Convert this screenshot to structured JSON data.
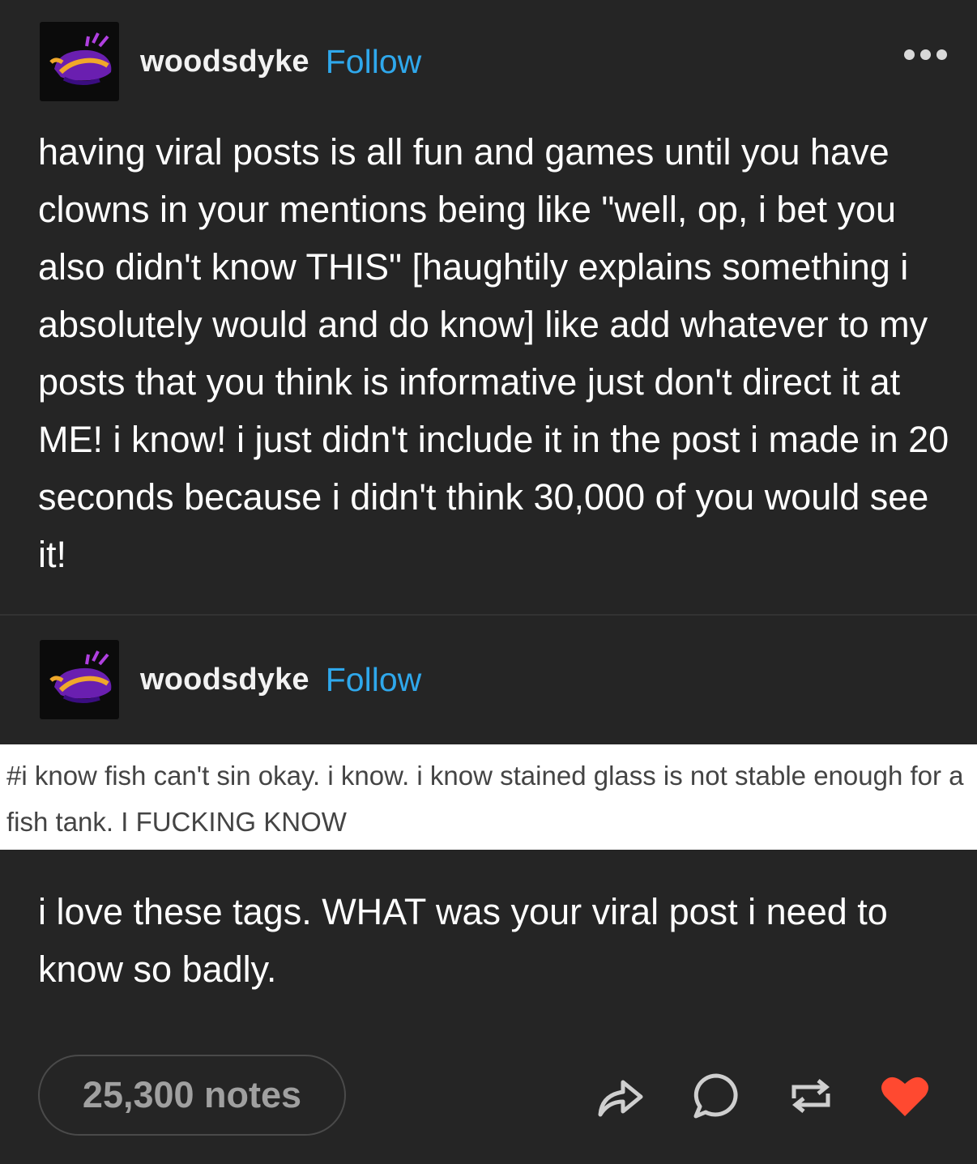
{
  "original_post": {
    "author": "woodsdyke",
    "follow_label": "Follow",
    "text": "having viral posts is all fun and games until you have clowns in your mentions being like \"well, op, i bet you also didn't know THIS\" [haughtily explains something i absolutely would and do know] like add whatever to my posts that you think is informative just don't direct it at ME! i know! i just didn't include it in the post i made in 20 seconds because i didn't think 30,000 of you would see it!"
  },
  "reblog": {
    "author": "woodsdyke",
    "follow_label": "Follow",
    "tags": "#i know fish can't sin okay. i know. i know stained glass is not stable enough for a fish tank. I FUCKING KNOW"
  },
  "reply": {
    "text": "i love these tags. WHAT was your viral post i need to know so badly."
  },
  "footer": {
    "notes": "25,300 notes",
    "icons": [
      "share-icon",
      "reply-icon",
      "reblog-icon",
      "like-icon"
    ],
    "like_color": "#ff4930"
  },
  "colors": {
    "background": "#252525",
    "follow": "#2fa8ec"
  }
}
